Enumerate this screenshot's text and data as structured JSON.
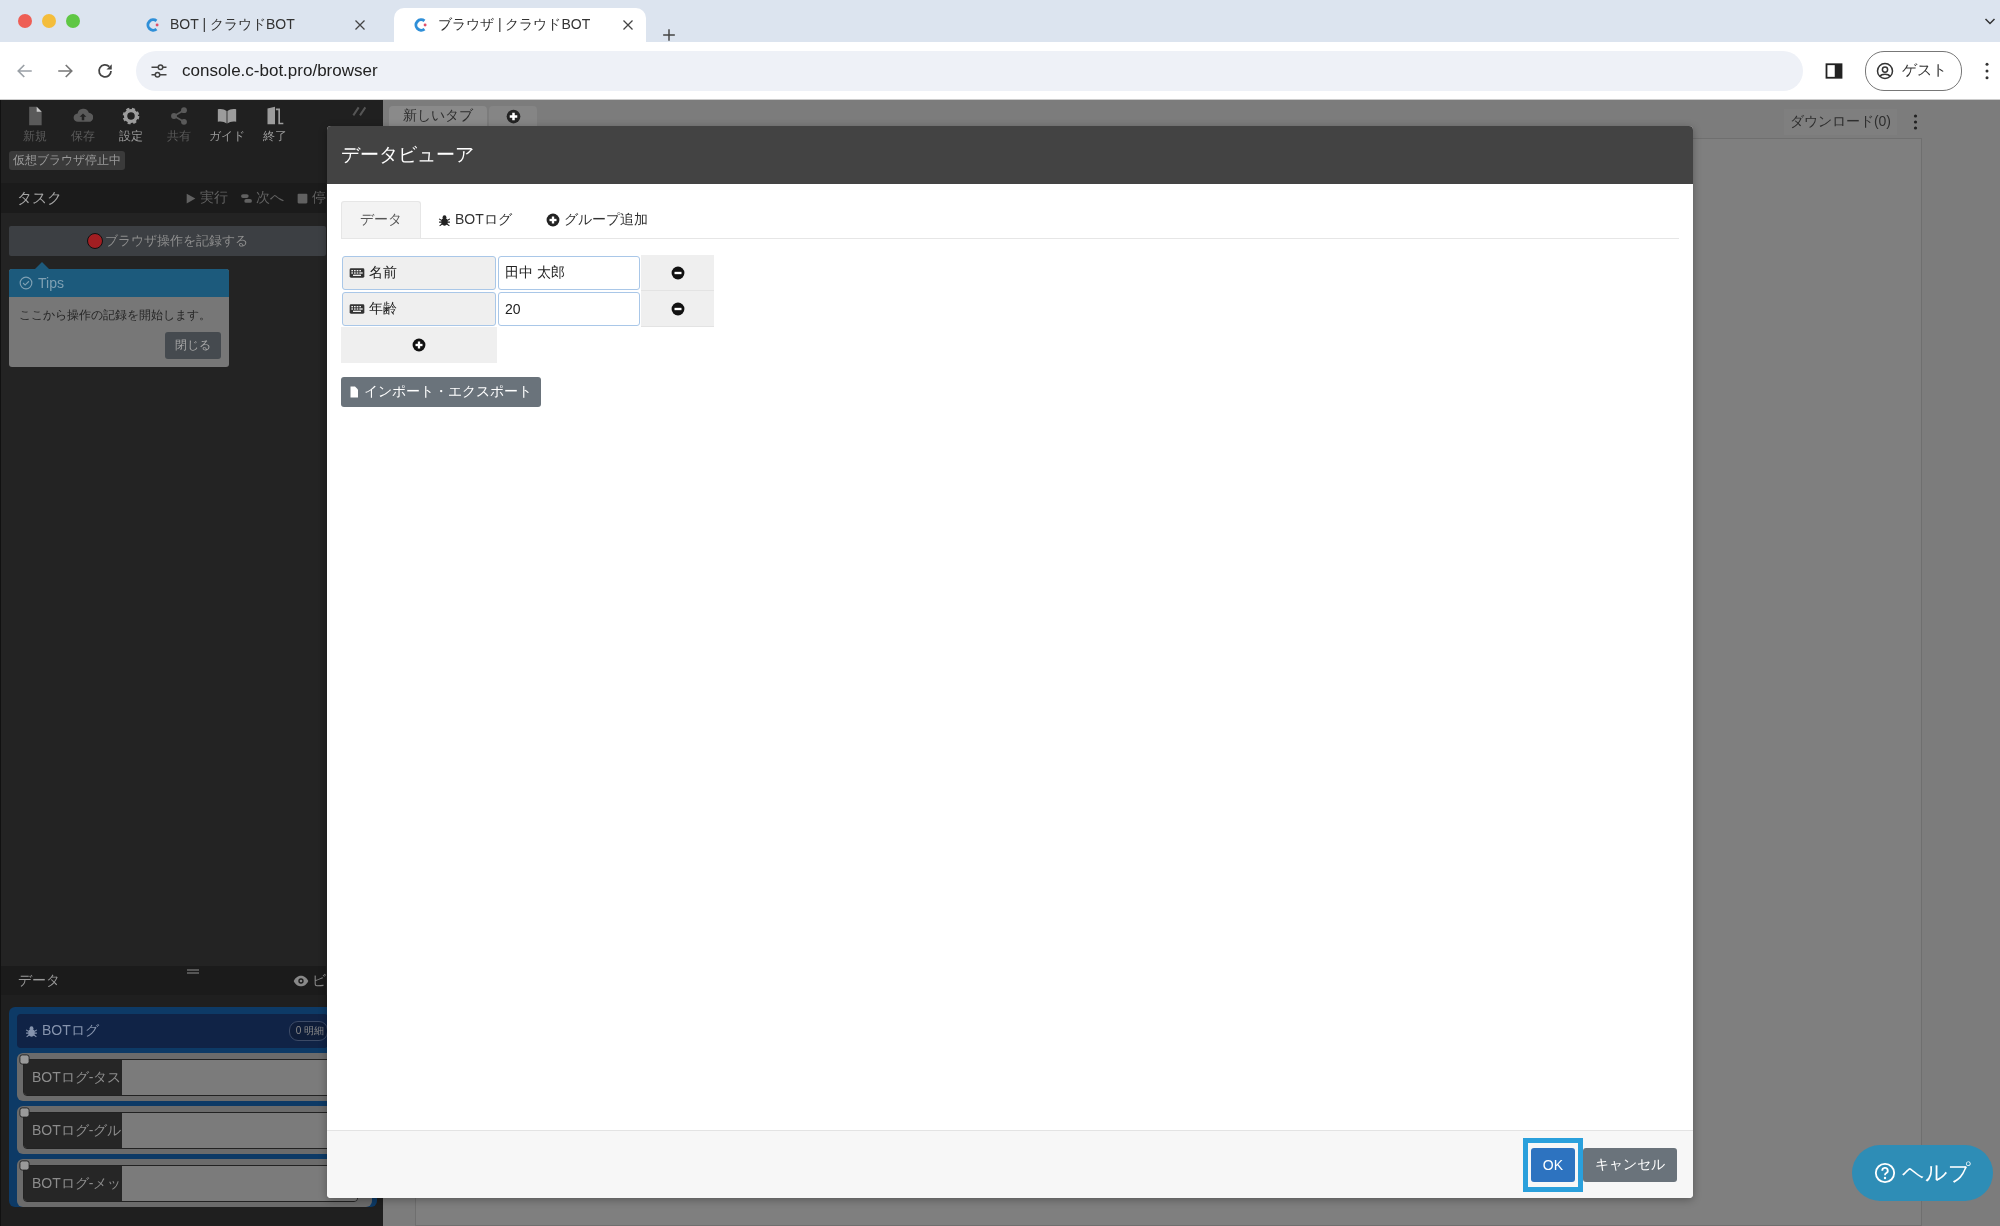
{
  "browser": {
    "tabs": [
      {
        "title": "BOT | クラウドBOT",
        "selected": false
      },
      {
        "title": "ブラウザ | クラウドBOT",
        "selected": true
      }
    ],
    "url": "console.c-bot.pro/browser",
    "profile": "ゲスト"
  },
  "toolbar": [
    {
      "label": "新規",
      "kind": "file",
      "disabled": true
    },
    {
      "label": "保存",
      "kind": "cloud",
      "disabled": true
    },
    {
      "label": "設定",
      "kind": "gear",
      "disabled": false
    },
    {
      "label": "共有",
      "kind": "share",
      "disabled": true
    },
    {
      "label": "ガイド",
      "kind": "book",
      "disabled": false
    },
    {
      "label": "終了",
      "kind": "door",
      "disabled": false
    }
  ],
  "status_badge": "仮想ブラウザ停止中",
  "task_panel": {
    "title": "タスク",
    "actions": [
      {
        "label": "実行",
        "kind": "play"
      },
      {
        "label": "次へ",
        "kind": "step"
      },
      {
        "label": "停",
        "kind": "stop"
      }
    ],
    "record_button": "ブラウザ操作を記録する"
  },
  "tips": {
    "title": "Tips",
    "message": "ここから操作の記録を開始します。",
    "close_button": "閉じる"
  },
  "data_panel": {
    "title": "データ",
    "view_button": "ビ",
    "group": {
      "title": "BOTログ",
      "count": "0 明細",
      "items": [
        "BOTログ-タス",
        "BOTログ-グル",
        "BOTログ-メッ"
      ]
    }
  },
  "page_tabs": [
    "新しいタブ"
  ],
  "download": "ダウンロード(0)",
  "dialog": {
    "title": "データビューア",
    "tabs": [
      {
        "label": "データ",
        "kind": "plain",
        "selected": true
      },
      {
        "label": "BOTログ",
        "kind": "bug",
        "selected": false
      },
      {
        "label": "グループ追加",
        "kind": "plus",
        "selected": false
      }
    ],
    "fields": [
      {
        "name": "名前",
        "value": "田中 太郎"
      },
      {
        "name": "年齢",
        "value": "20"
      }
    ],
    "import_export_button": "インポート・エクスポート",
    "ok_button": "OK",
    "ok_highlighted": true,
    "cancel_button": "キャンセル"
  },
  "help_button": "ヘルプ"
}
